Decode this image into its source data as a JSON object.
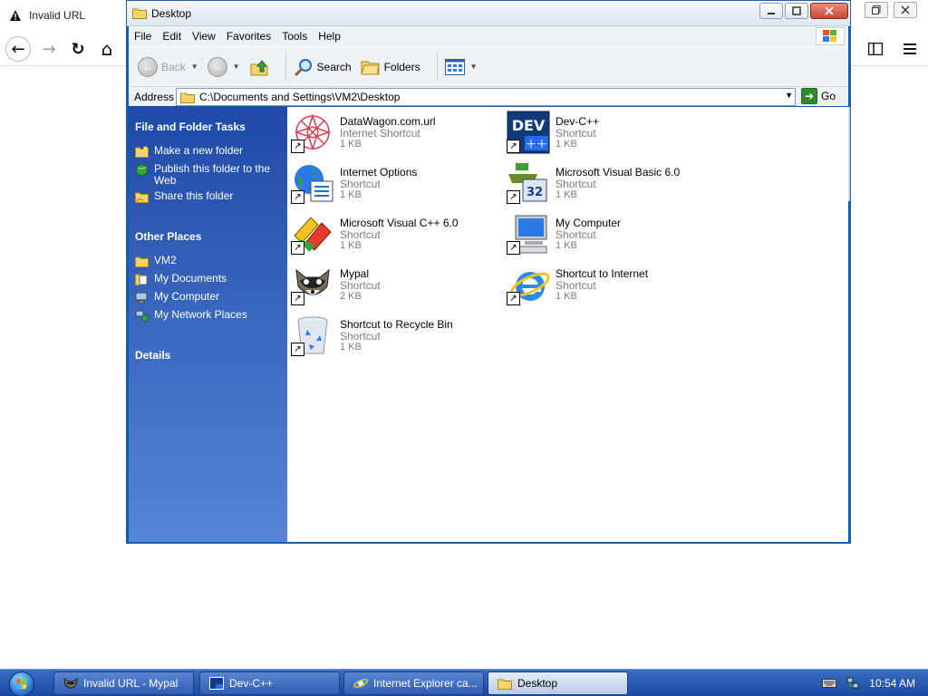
{
  "browser": {
    "tab_title": "Invalid URL",
    "nav": {
      "back": "←",
      "forward": "→",
      "reload": "↻",
      "home": "⌂"
    }
  },
  "window": {
    "title": "Desktop",
    "menu": [
      "File",
      "Edit",
      "View",
      "Favorites",
      "Tools",
      "Help"
    ],
    "toolbar": {
      "back_label": "Back",
      "search_label": "Search",
      "folders_label": "Folders"
    },
    "address": {
      "label": "Address",
      "value": "C:\\Documents and Settings\\VM2\\Desktop",
      "go_label": "Go"
    }
  },
  "taskpane": {
    "file_tasks_heading": "File and Folder Tasks",
    "file_tasks": [
      {
        "label": "Make a new folder",
        "icon": "new-folder-icon"
      },
      {
        "label": "Publish this folder to the Web",
        "icon": "globe-icon"
      },
      {
        "label": "Share this folder",
        "icon": "share-folder-icon"
      }
    ],
    "other_places_heading": "Other Places",
    "other_places": [
      {
        "label": "VM2",
        "icon": "folder-icon"
      },
      {
        "label": "My Documents",
        "icon": "documents-icon"
      },
      {
        "label": "My Computer",
        "icon": "computer-icon"
      },
      {
        "label": "My Network Places",
        "icon": "network-icon"
      }
    ],
    "details_heading": "Details"
  },
  "files": [
    {
      "name": "DataWagon.com.url",
      "type": "Internet Shortcut",
      "size": "1 KB",
      "icon": "datawagon-icon"
    },
    {
      "name": "Dev-C++",
      "type": "Shortcut",
      "size": "1 KB",
      "icon": "devcpp-icon"
    },
    {
      "name": "Internet Options",
      "type": "Shortcut",
      "size": "1 KB",
      "icon": "internet-options-icon"
    },
    {
      "name": "Microsoft Visual Basic 6.0",
      "type": "Shortcut",
      "size": "1 KB",
      "icon": "vb6-icon"
    },
    {
      "name": "Microsoft Visual C++ 6.0",
      "type": "Shortcut",
      "size": "1 KB",
      "icon": "vcpp-icon"
    },
    {
      "name": "My Computer",
      "type": "Shortcut",
      "size": "1 KB",
      "icon": "my-computer-icon"
    },
    {
      "name": "Mypal",
      "type": "Shortcut",
      "size": "2 KB",
      "icon": "mypal-icon"
    },
    {
      "name": "Shortcut to Internet",
      "type": "Shortcut",
      "size": "1 KB",
      "icon": "ie-icon"
    },
    {
      "name": "Shortcut to Recycle Bin",
      "type": "Shortcut",
      "size": "1 KB",
      "icon": "recycle-bin-icon"
    }
  ],
  "taskbar": {
    "items": [
      {
        "label": "Invalid URL - Mypal"
      },
      {
        "label": "Dev-C++"
      },
      {
        "label": "Internet Explorer ca..."
      },
      {
        "label": "Desktop"
      }
    ],
    "clock": "10:54 AM"
  },
  "colors": {
    "taskpane_top": "#1f4aa8",
    "taskpane_bottom": "#5685d6",
    "taskbar": "#2a5bb5"
  }
}
